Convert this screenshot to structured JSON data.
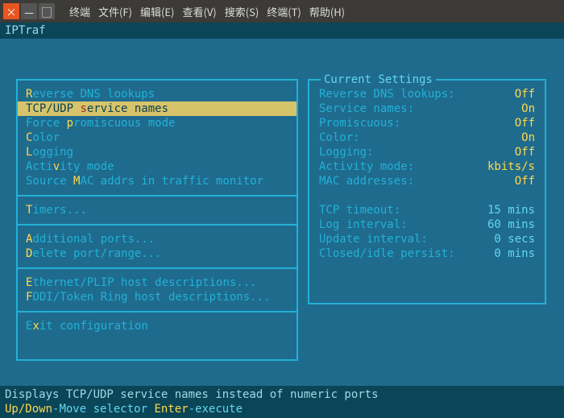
{
  "window": {
    "menus": [
      "终端",
      "文件(F)",
      "编辑(E)",
      "查看(V)",
      "搜索(S)",
      "终端(T)",
      "帮助(H)"
    ],
    "closeGlyph": "×",
    "minGlyph": "—",
    "maxGlyph": "▢"
  },
  "app": {
    "tab": "IPTraf"
  },
  "menu": {
    "items": [
      {
        "pre": "",
        "hl": "R",
        "post": "everse DNS lookups",
        "sel": false
      },
      {
        "pre": "TCP/UDP ",
        "hl": "s",
        "post": "ervice names",
        "sel": true
      },
      {
        "pre": "Force ",
        "hl": "p",
        "post": "romiscuous mode",
        "sel": false
      },
      {
        "pre": "",
        "hl": "C",
        "post": "olor",
        "sel": false
      },
      {
        "pre": "",
        "hl": "L",
        "post": "ogging",
        "sel": false
      },
      {
        "pre": "Acti",
        "hl": "v",
        "post": "ity mode",
        "sel": false
      },
      {
        "pre": "Source ",
        "hl": "M",
        "post": "AC addrs in traffic monitor",
        "sel": false
      }
    ],
    "timers": {
      "pre": "",
      "hl": "T",
      "post": "imers..."
    },
    "addports": {
      "pre": "",
      "hl": "A",
      "post": "dditional ports..."
    },
    "delports": {
      "pre": "",
      "hl": "D",
      "post": "elete port/range..."
    },
    "ethdesc": {
      "pre": "",
      "hl": "E",
      "post": "thernet/PLIP host descriptions..."
    },
    "fddidesc": {
      "pre": "",
      "hl": "F",
      "post": "DDI/Token Ring host descriptions..."
    },
    "exit": {
      "pre": "E",
      "hl": "x",
      "post": "it configuration"
    }
  },
  "settings": {
    "legend": "Current Settings",
    "rows": [
      {
        "label": "Reverse DNS lookups:",
        "value": "Off"
      },
      {
        "label": "Service names:",
        "value": "On"
      },
      {
        "label": "Promiscuous:",
        "value": "Off"
      },
      {
        "label": "Color:",
        "value": "On"
      },
      {
        "label": "Logging:",
        "value": "Off"
      },
      {
        "label": "Activity mode:",
        "value": "kbits/s"
      },
      {
        "label": "MAC addresses:",
        "value": "Off"
      }
    ],
    "timers": [
      {
        "label": "TCP timeout:",
        "value": "15 mins"
      },
      {
        "label": "Log interval:",
        "value": "60 mins"
      },
      {
        "label": "Update interval:",
        "value": "0 secs"
      },
      {
        "label": "Closed/idle persist:",
        "value": "0 mins"
      }
    ]
  },
  "status": {
    "desc": "Displays TCP/UDP service names instead of numeric ports",
    "k1": "Up/Down",
    "t1": "-Move selector  ",
    "k2": "Enter",
    "t2": "-execute"
  }
}
